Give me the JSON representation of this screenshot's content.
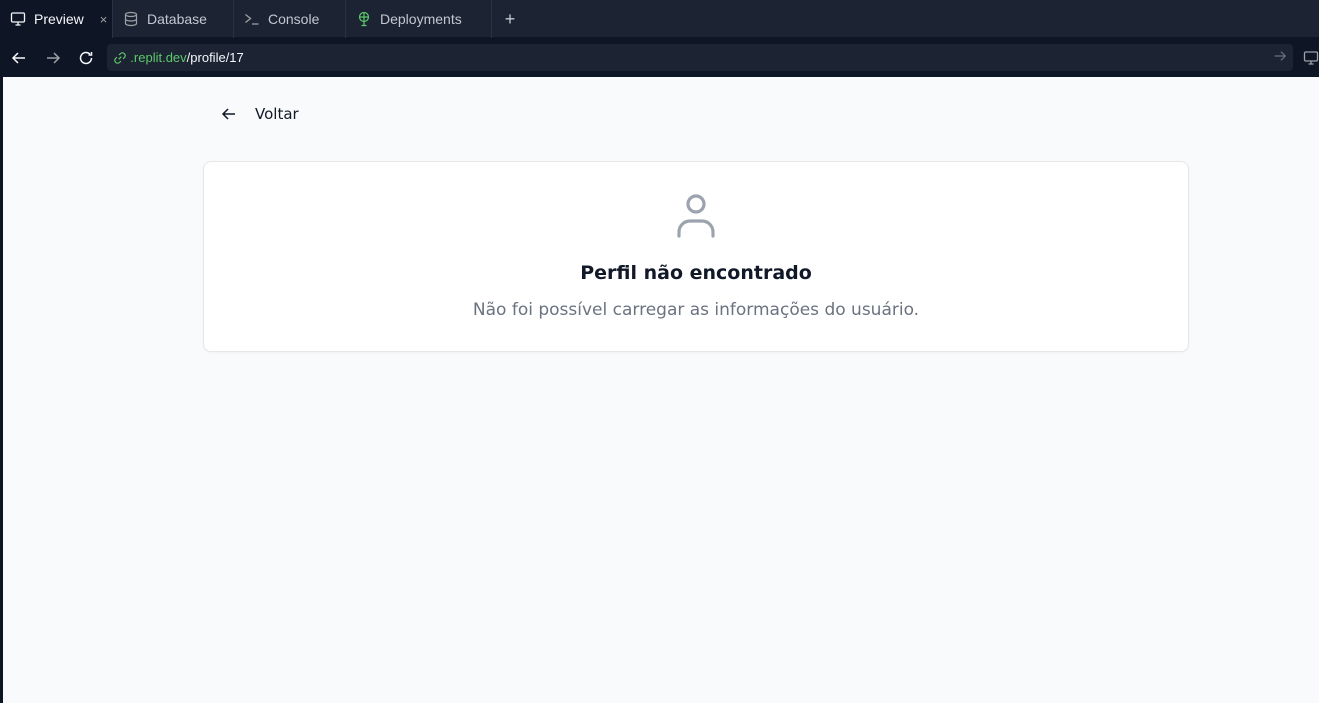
{
  "tabs": [
    {
      "label": "Preview",
      "icon": "monitor-icon",
      "active": true
    },
    {
      "label": "Database",
      "icon": "database-icon"
    },
    {
      "label": "Console",
      "icon": "terminal-icon"
    },
    {
      "label": "Deployments",
      "icon": "deployments-icon"
    }
  ],
  "tab_close_glyph": "×",
  "add_tab_glyph": "+",
  "address": {
    "host": ".replit.dev",
    "path": "/profile/17"
  },
  "page": {
    "back_label": "Voltar",
    "title": "Perfil não encontrado",
    "message": "Não foi possível carregar as informações do usuário."
  },
  "colors": {
    "url_host": "#5cc96b",
    "deploy_icon": "#5cc96b",
    "page_bg": "#f9fafb",
    "muted_text": "#6b7280",
    "user_icon": "#9ca3af"
  }
}
